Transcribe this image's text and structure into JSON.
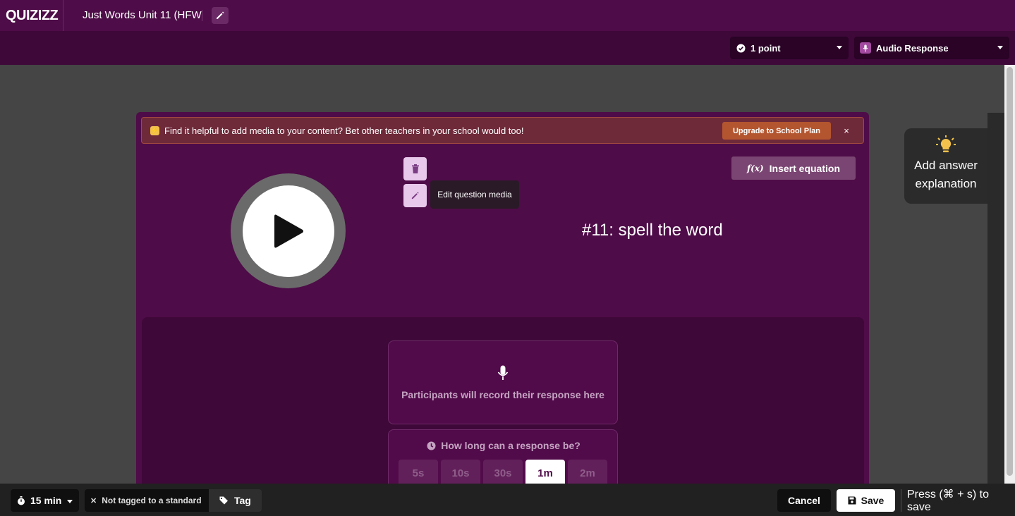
{
  "header": {
    "logo": "QUIZIZZ",
    "quiz_title": "Just Words Unit 11 (HFW l"
  },
  "toolbar": {
    "points": "1 point",
    "question_type": "Audio Response"
  },
  "banner": {
    "message": "Find it helpful to add media to your content? Bet other teachers in your school would too!",
    "upgrade_label": "Upgrade to School Plan",
    "close_label": "×"
  },
  "media": {
    "tooltip": "Edit question media"
  },
  "editor": {
    "insert_equation_label": "Insert equation",
    "question_text": "#11: spell the word"
  },
  "response": {
    "record_text": "Participants will record their response here",
    "length_title": "How long can a response be?",
    "length_options": [
      "5s",
      "10s",
      "30s",
      "1m",
      "2m"
    ],
    "selected_length": "1m"
  },
  "explanation": {
    "label_line1": "Add answer",
    "label_line2": "explanation"
  },
  "footer": {
    "time_label": "15 min",
    "standard_label": "Not tagged to a standard",
    "tag_label": "Tag",
    "cancel_label": "Cancel",
    "save_label": "Save",
    "save_hint": "Press (⌘ + s) to save"
  },
  "colors": {
    "brand_purple": "#4e0c48",
    "banner_bg": "#6f2a3a",
    "upgrade_orange": "#b3552f",
    "bulb_yellow": "#f4c24c"
  }
}
